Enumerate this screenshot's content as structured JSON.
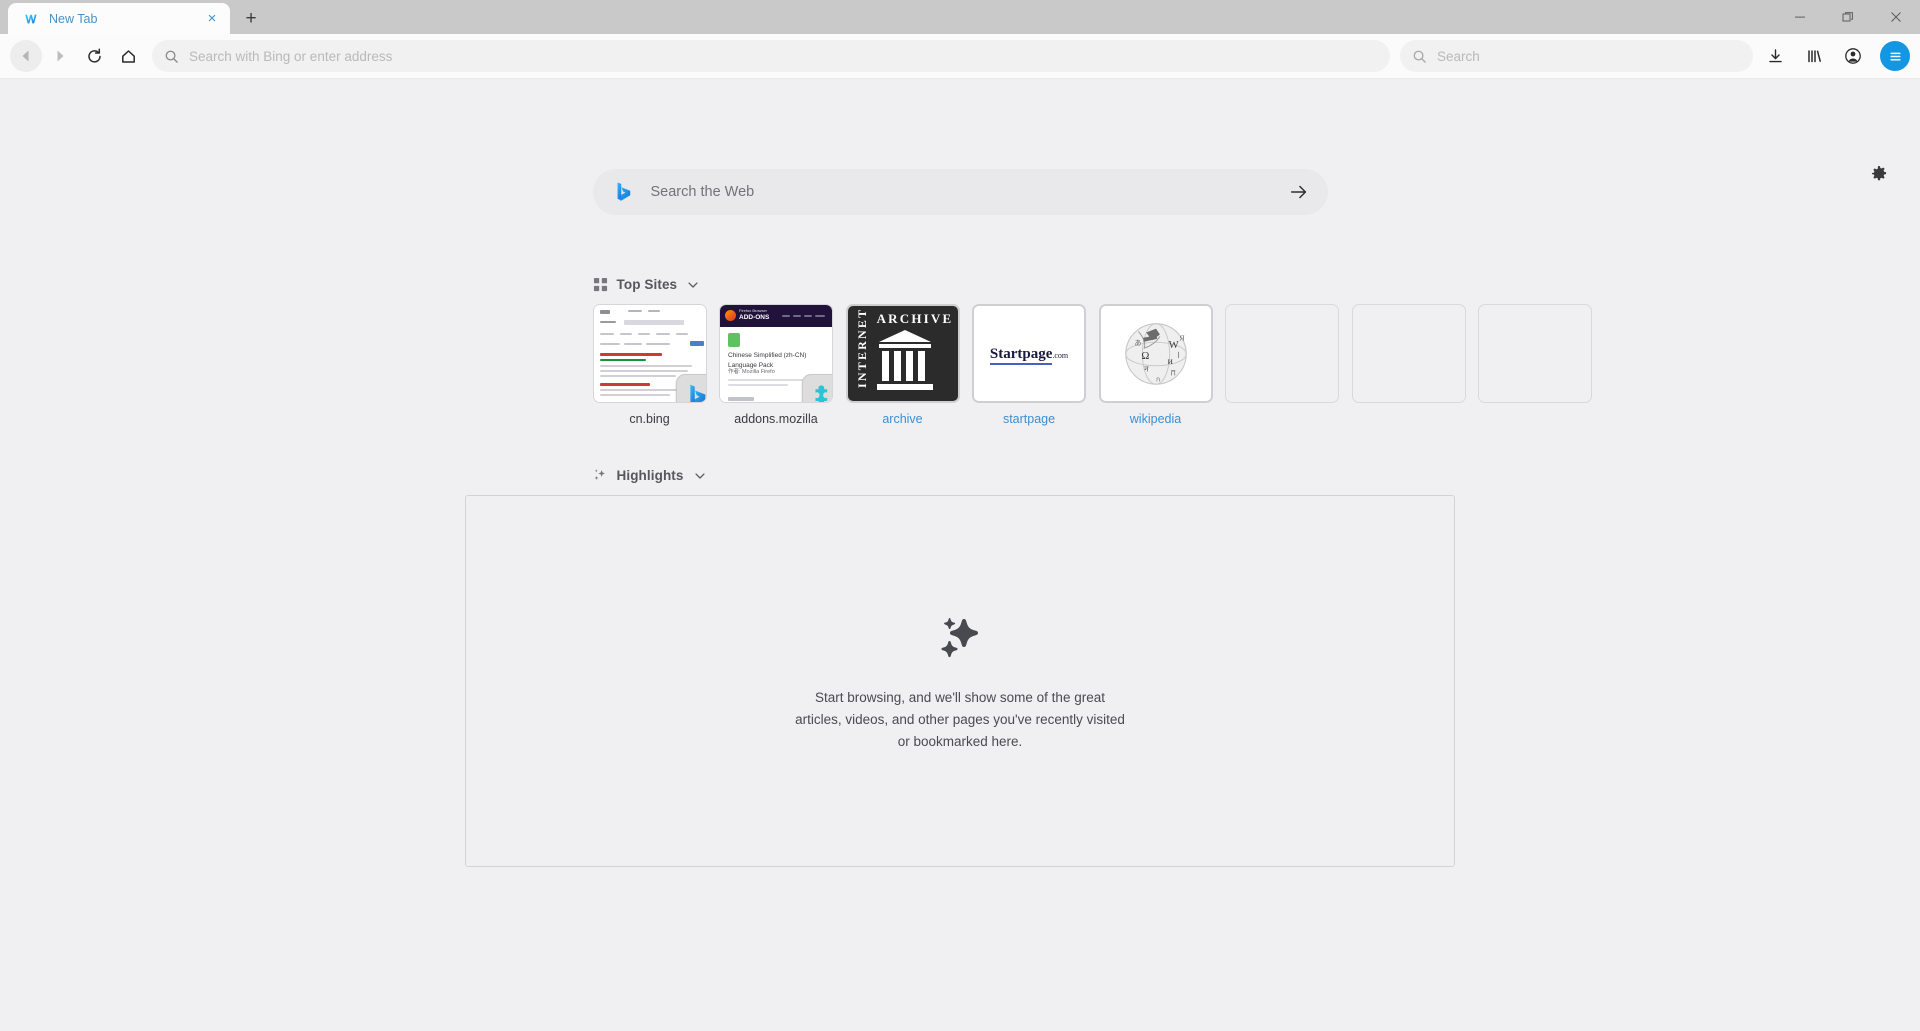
{
  "window": {
    "minimize_label": "Minimize",
    "restore_label": "Restore",
    "close_label": "Close"
  },
  "tabbar": {
    "tabs": [
      {
        "title": "New Tab",
        "favicon": "waterfox-w-icon",
        "close_label": "×"
      }
    ],
    "new_tab_label": "+"
  },
  "toolbar": {
    "back": "back-icon",
    "forward": "forward-icon",
    "reload": "reload-icon",
    "home": "home-icon",
    "url_placeholder": "Search with Bing or enter address",
    "url_value": "",
    "search_placeholder": "Search",
    "search_value": "",
    "downloads": "download-icon",
    "library": "library-icon",
    "account": "account-icon",
    "menu": "hamburger-icon"
  },
  "content": {
    "prefs_icon": "gear-icon",
    "hero_search": {
      "engine_icon": "bing-logo-icon",
      "placeholder": "Search the Web",
      "value": "",
      "submit_icon": "arrow-right-icon"
    },
    "top_sites": {
      "icon": "grid-icon",
      "title": "Top Sites",
      "chevron": "chevron-down-icon",
      "tiles": [
        {
          "label": "cn.bing",
          "kind": "screenshot-bing",
          "link": false,
          "framed": false,
          "badge": "bing-logo-icon"
        },
        {
          "label": "addons.mozilla",
          "kind": "screenshot-addons",
          "link": false,
          "framed": false,
          "badge": "puzzle-piece-icon"
        },
        {
          "label": "archive",
          "kind": "logo-archive",
          "link": true,
          "framed": true,
          "badge": ""
        },
        {
          "label": "startpage",
          "kind": "logo-startpage",
          "link": true,
          "framed": true,
          "badge": ""
        },
        {
          "label": "wikipedia",
          "kind": "logo-wikipedia",
          "link": true,
          "framed": true,
          "badge": ""
        },
        {
          "label": "",
          "kind": "empty",
          "link": false,
          "framed": false,
          "badge": ""
        },
        {
          "label": "",
          "kind": "empty",
          "link": false,
          "framed": false,
          "badge": ""
        },
        {
          "label": "",
          "kind": "empty",
          "link": false,
          "framed": false,
          "badge": ""
        }
      ]
    },
    "highlights": {
      "icon": "sparkle-icon",
      "title": "Highlights",
      "chevron": "chevron-down-icon",
      "empty_icon": "sparkle-large-icon",
      "empty_text": "Start browsing, and we'll show some of the great articles, videos, and other pages you've recently visited or bookmarked here."
    },
    "thumb_text": {
      "addons_brand": "ADD-ONS",
      "addons_title_1": "Chinese Simplified (zh-CN)",
      "addons_title_2": "Language Pack",
      "addons_author": "作者:  Mozilla Firefo",
      "archive_word_top": "ARCHIVE",
      "archive_word_side": "INTERNET",
      "startpage_brand": "Startpage",
      "startpage_tld": ".com"
    }
  },
  "colors": {
    "accent_blue": "#3a8fd4",
    "menu_blue": "#1496e0",
    "tabbar_gray": "#c9c9c9",
    "page_bg": "#f0f0f2"
  }
}
